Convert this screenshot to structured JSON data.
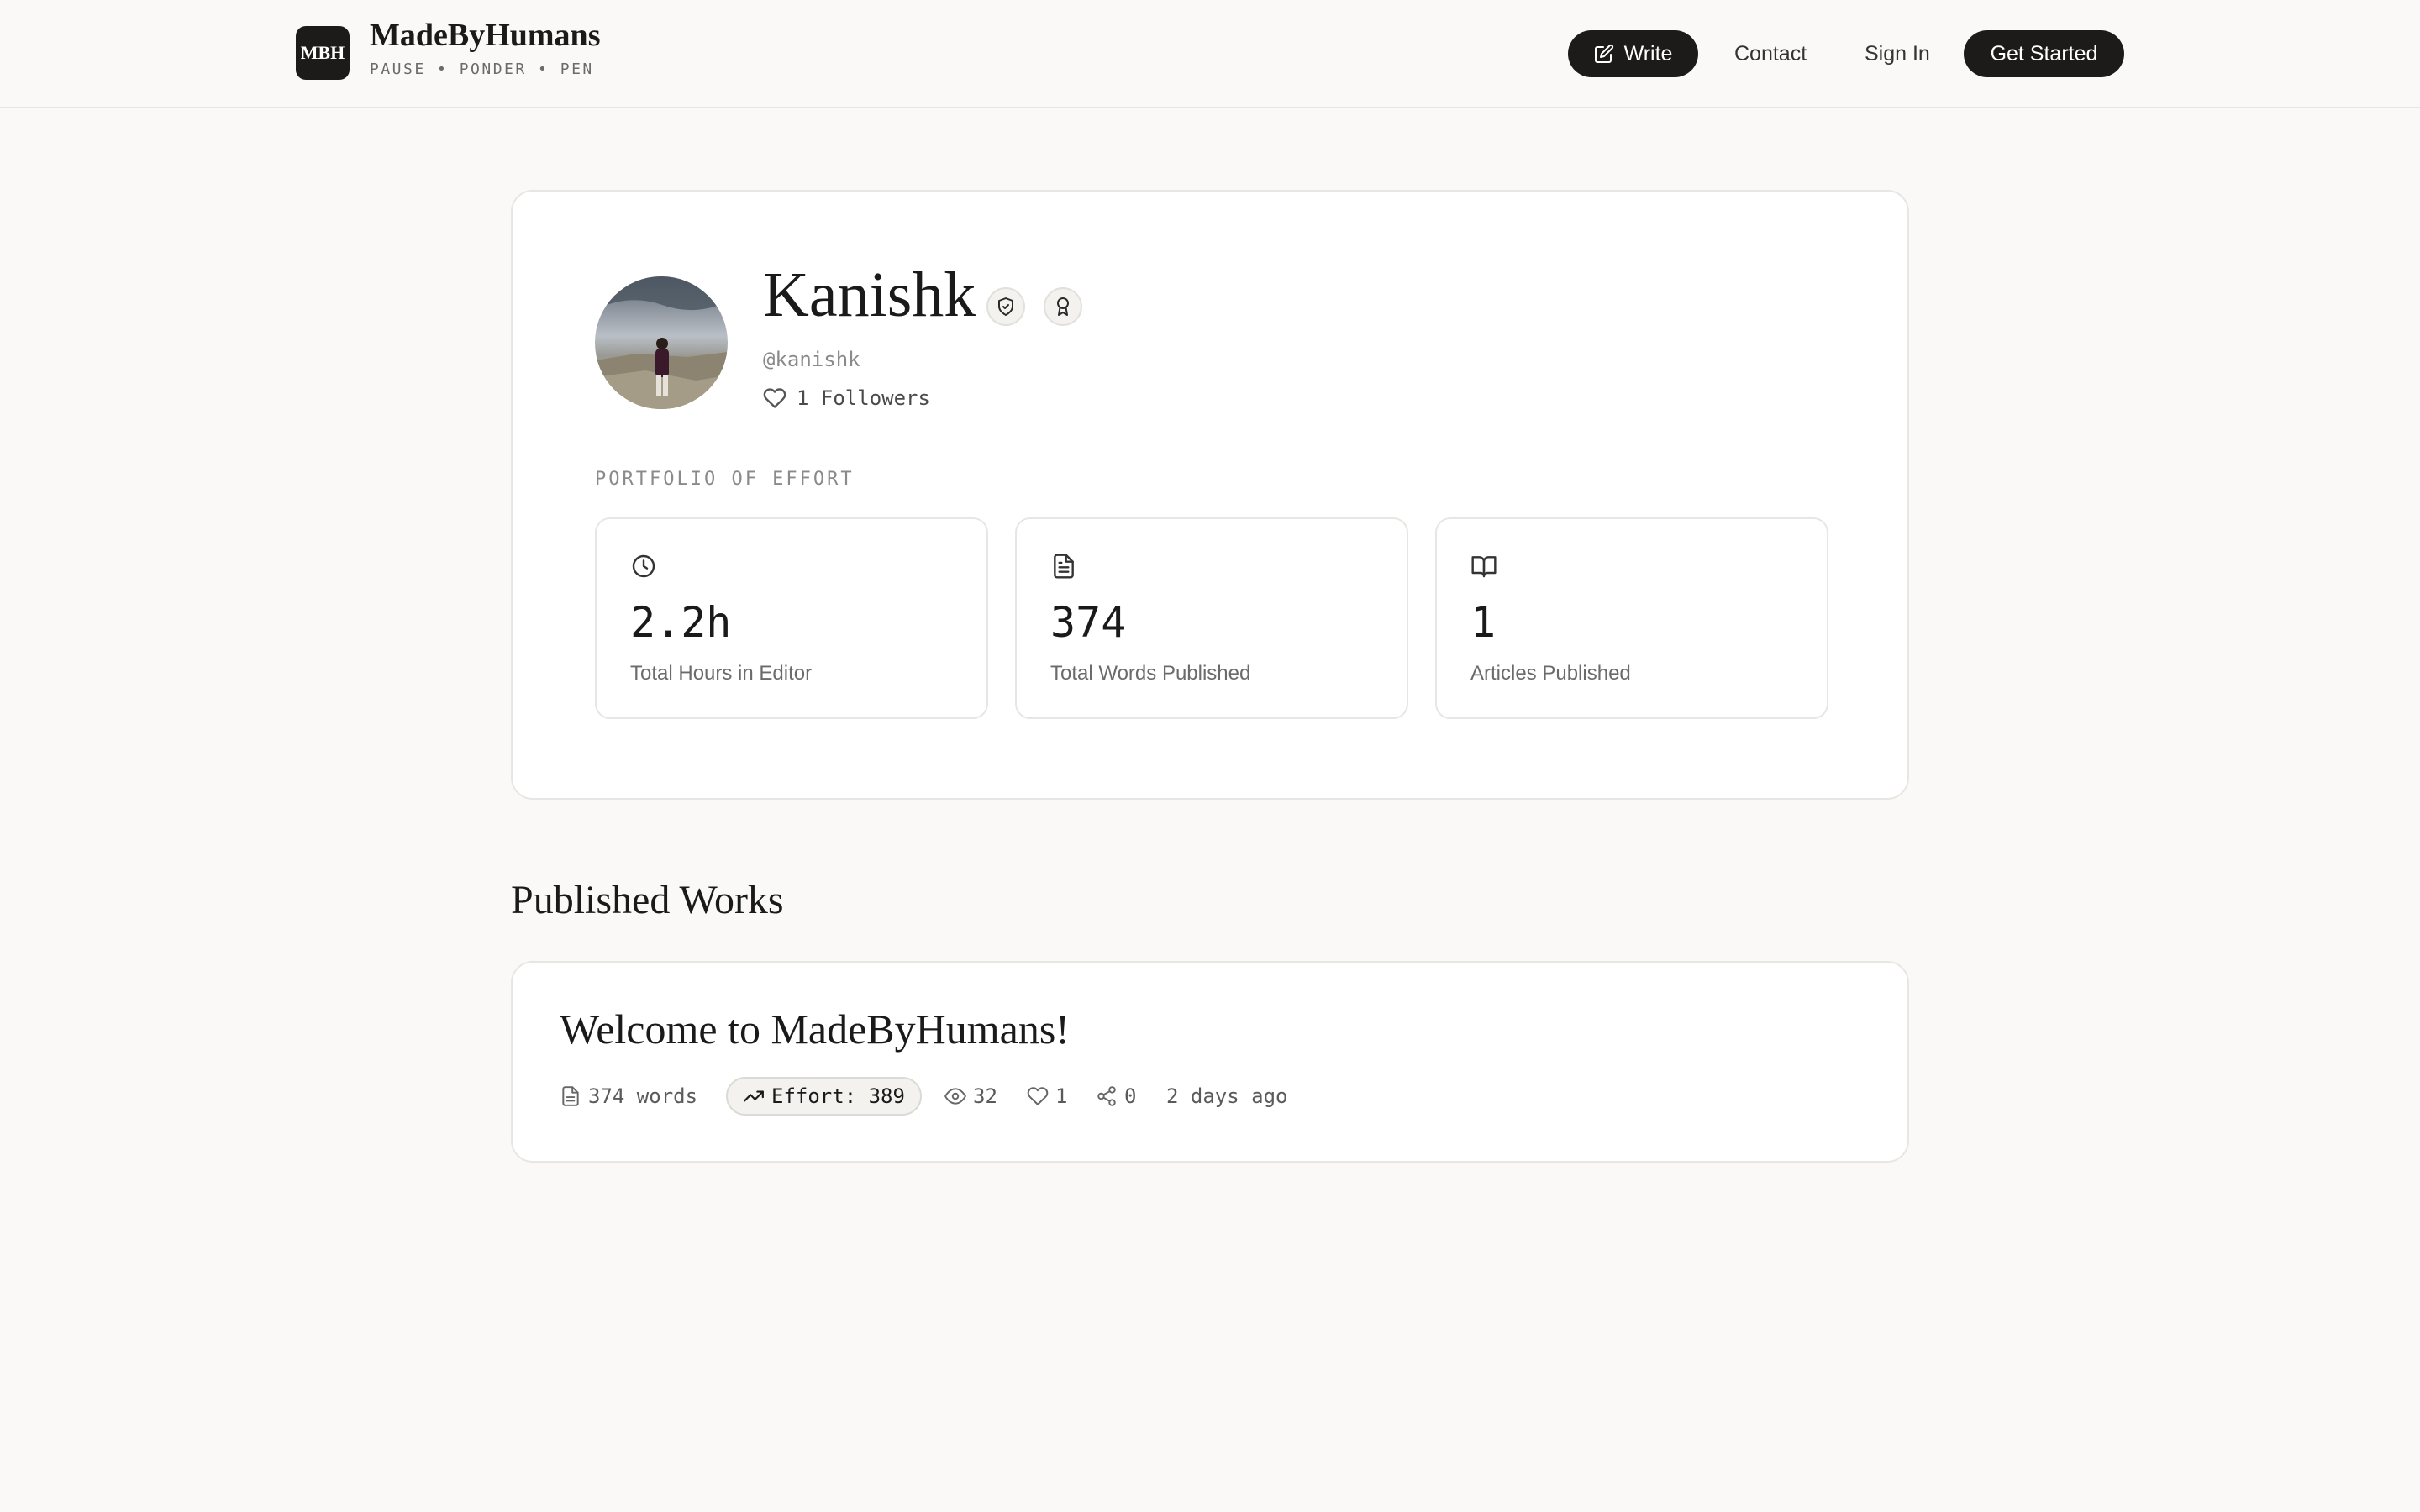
{
  "header": {
    "logo_text": "MBH",
    "brand_name": "MadeByHumans",
    "tagline": "PAUSE • PONDER • PEN",
    "nav": {
      "write_label": "Write",
      "contact_label": "Contact",
      "signin_label": "Sign In",
      "get_started_label": "Get Started"
    }
  },
  "profile": {
    "name": "Kanishk",
    "handle": "@kanishk",
    "followers": "1 Followers",
    "badges": [
      "shield-check-icon",
      "award-icon"
    ],
    "portfolio_label": "PORTFOLIO OF EFFORT",
    "stats": [
      {
        "icon": "clock-icon",
        "value": "2.2h",
        "label": "Total Hours in Editor"
      },
      {
        "icon": "document-icon",
        "value": "374",
        "label": "Total Words Published"
      },
      {
        "icon": "book-open-icon",
        "value": "1",
        "label": "Articles Published"
      }
    ]
  },
  "published": {
    "section_title": "Published Works",
    "articles": [
      {
        "title": "Welcome to MadeByHumans!",
        "words": "374 words",
        "effort": "Effort: 389",
        "views": "32",
        "likes": "1",
        "shares": "0",
        "date": "2 days ago"
      }
    ]
  },
  "colors": {
    "background": "#faf9f7",
    "card": "#ffffff",
    "primary": "#1c1b1a",
    "border": "#e8e6e2",
    "muted": "#8a8a8a"
  }
}
